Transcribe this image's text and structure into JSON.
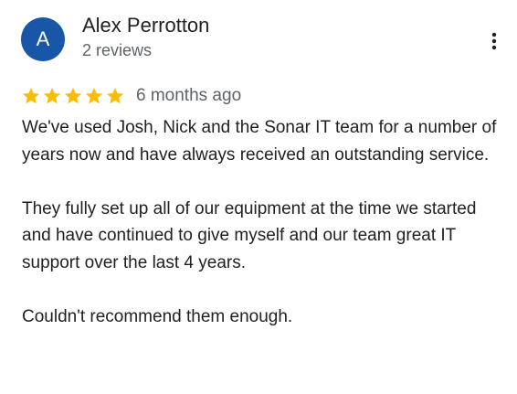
{
  "reviewer": {
    "initial": "A",
    "name": "Alex Perrotton",
    "review_count": "2 reviews",
    "avatar_color": "#1a56a8"
  },
  "menu": {
    "icon": "more-vert-icon"
  },
  "review": {
    "rating": 5,
    "rating_max": 5,
    "star_color": "#fbbc04",
    "timestamp": "6 months ago",
    "paragraphs": [
      "We've used Josh, Nick and the Sonar IT team for a number of years now and have always received an outstanding service.",
      "They fully set up all of our equipment at the time we started and have continued to give myself and our team great IT support over the last 4 years.",
      "Couldn't recommend them enough."
    ]
  }
}
